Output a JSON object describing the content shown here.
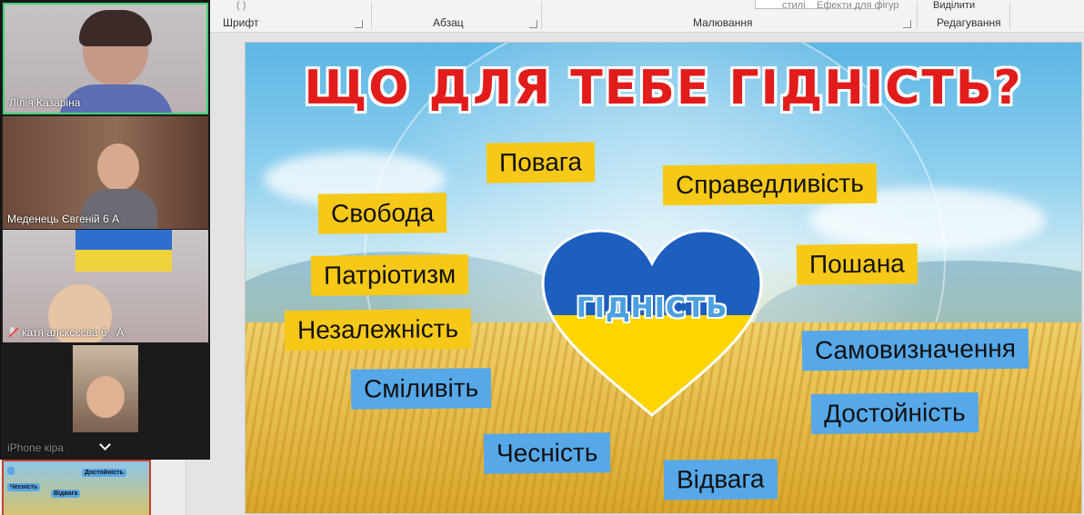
{
  "ribbon": {
    "groups": [
      "Шрифт",
      "Абзац",
      "Малювання",
      "Редагування"
    ],
    "styles_label": "стилі",
    "effects_label": "Ефекти для фігур",
    "select_label": "Виділити"
  },
  "slide": {
    "title": "ЩО ДЛЯ ТЕБЕ ГІДНІСТЬ?",
    "heart_label": "ГІДНІСТЬ",
    "words": [
      {
        "text": "Повага",
        "color": "yellow"
      },
      {
        "text": "Справедливість",
        "color": "yellow"
      },
      {
        "text": "Свобода",
        "color": "yellow"
      },
      {
        "text": "Пошана",
        "color": "yellow"
      },
      {
        "text": "Патріотизм",
        "color": "yellow"
      },
      {
        "text": "Незалежність",
        "color": "yellow"
      },
      {
        "text": "Самовизначення",
        "color": "blue"
      },
      {
        "text": "Сміливіть",
        "color": "blue"
      },
      {
        "text": "Достойність",
        "color": "blue"
      },
      {
        "text": "Чесність",
        "color": "blue"
      },
      {
        "text": "Відвага",
        "color": "blue"
      }
    ]
  },
  "thumbnail": {
    "labels": [
      "Достойність",
      "Чесність",
      "Відвага"
    ]
  },
  "video": {
    "participants": [
      {
        "name": "Лілія Казаріна",
        "muted": false
      },
      {
        "name": "Меденець Євгеній 6 А",
        "muted": false
      },
      {
        "name": "катя алєксєєва 6 - А",
        "muted": true
      },
      {
        "name": "iPhone кіра",
        "muted": false
      }
    ]
  },
  "colors": {
    "title_red": "#e21b1b",
    "word_yellow": "#f6c818",
    "word_blue": "#56a8e8",
    "active_speaker": "#3fd27a",
    "thumb_border": "#c6412b"
  }
}
